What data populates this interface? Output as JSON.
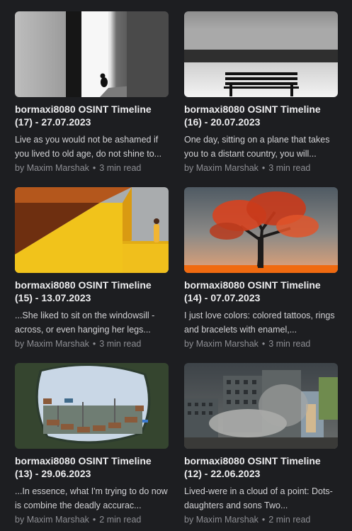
{
  "posts": [
    {
      "title": "bormaxi8080 OSINT Timeline\n(17) - 27.07.2023",
      "excerpt": "Live as you would not be ashamed if you lived to old age, do not shine to...",
      "author_prefix": "by",
      "author": "Maxim Marshak",
      "separator": "•",
      "read_time": "3 min read",
      "image_icon": "cat-in-doorway-image"
    },
    {
      "title": "bormaxi8080 OSINT Timeline\n(16) - 20.07.2023",
      "excerpt": "One day, sitting on a plane that takes you to a distant country, you will...",
      "author_prefix": "by",
      "author": "Maxim Marshak",
      "separator": "•",
      "read_time": "3 min read",
      "image_icon": "bench-by-sea-image"
    },
    {
      "title": "bormaxi8080 OSINT Timeline\n(15) - 13.07.2023",
      "excerpt": "...She liked to sit on the windowsill - across, or even hanging her legs...",
      "author_prefix": "by",
      "author": "Maxim Marshak",
      "separator": "•",
      "read_time": "3 min read",
      "image_icon": "woman-yellow-wall-image"
    },
    {
      "title": "bormaxi8080 OSINT Timeline\n(14) - 07.07.2023",
      "excerpt": "I just love colors: colored tattoos, rings and bracelets with enamel,...",
      "author_prefix": "by",
      "author": "Maxim Marshak",
      "separator": "•",
      "read_time": "3 min read",
      "image_icon": "red-tree-image"
    },
    {
      "title": "bormaxi8080 OSINT Timeline\n(13) - 29.06.2023",
      "excerpt": "...In essence, what I'm trying to do now is combine the deadly accurac...",
      "author_prefix": "by",
      "author": "Maxim Marshak",
      "separator": "•",
      "read_time": "2 min read",
      "image_icon": "hole-in-wall-image"
    },
    {
      "title": "bormaxi8080 OSINT Timeline\n(12) - 22.06.2023",
      "excerpt": "Lived-were in a cloud of a point: Dots-daughters and sons Two...",
      "author_prefix": "by",
      "author": "Maxim Marshak",
      "separator": "•",
      "read_time": "2 min read",
      "image_icon": "ruined-buildings-image"
    }
  ],
  "colors": {
    "background": "#1d1e21",
    "title": "#ececee",
    "excerpt": "#d2d2d5",
    "meta": "#8d8e93"
  }
}
